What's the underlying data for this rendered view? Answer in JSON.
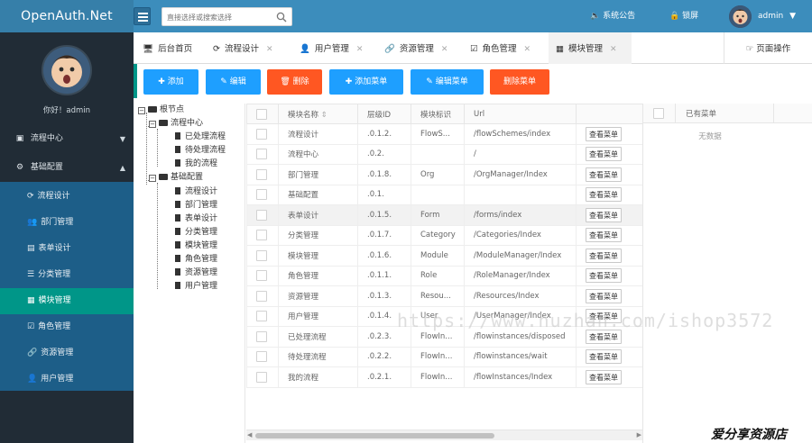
{
  "app": {
    "title": "OpenAuth.Net"
  },
  "header": {
    "search_placeholder": "直接选择或搜索选择",
    "announcement": "系统公告",
    "lock": "锁屏",
    "user": "admin"
  },
  "sidebar": {
    "greeting": "你好！admin",
    "groups": [
      {
        "label": "流程中心"
      },
      {
        "label": "基础配置"
      }
    ],
    "items": [
      {
        "label": "流程设计"
      },
      {
        "label": "部门管理"
      },
      {
        "label": "表单设计"
      },
      {
        "label": "分类管理"
      },
      {
        "label": "模块管理"
      },
      {
        "label": "角色管理"
      },
      {
        "label": "资源管理"
      },
      {
        "label": "用户管理"
      }
    ]
  },
  "tabs": [
    {
      "label": "后台首页"
    },
    {
      "label": "流程设计"
    },
    {
      "label": "用户管理"
    },
    {
      "label": "资源管理"
    },
    {
      "label": "角色管理"
    },
    {
      "label": "模块管理"
    }
  ],
  "page_ops": "页面操作",
  "toolbar": {
    "add": "添加",
    "edit": "编辑",
    "delete": "删除",
    "add_menu": "添加菜单",
    "edit_menu": "编辑菜单",
    "delete_menu": "删除菜单"
  },
  "tree": {
    "root": "根节点",
    "nodes": [
      {
        "label": "流程中心",
        "children": [
          "已处理流程",
          "待处理流程",
          "我的流程"
        ]
      },
      {
        "label": "基础配置",
        "children": [
          "流程设计",
          "部门管理",
          "表单设计",
          "分类管理",
          "模块管理",
          "角色管理",
          "资源管理",
          "用户管理"
        ]
      }
    ]
  },
  "grid": {
    "columns": [
      "模块名称",
      "层级ID",
      "模块标识",
      "Url",
      ""
    ],
    "view_label": "查看菜单",
    "rows": [
      {
        "name": "流程设计",
        "cascade": ".0.1.2.",
        "code": "FlowS...",
        "url": "/flowSchemes/index"
      },
      {
        "name": "流程中心",
        "cascade": ".0.2.",
        "code": "",
        "url": "/"
      },
      {
        "name": "部门管理",
        "cascade": ".0.1.8.",
        "code": "Org",
        "url": "/OrgManager/Index"
      },
      {
        "name": "基础配置",
        "cascade": ".0.1.",
        "code": "",
        "url": ""
      },
      {
        "name": "表单设计",
        "cascade": ".0.1.5.",
        "code": "Form",
        "url": "/forms/index"
      },
      {
        "name": "分类管理",
        "cascade": ".0.1.7.",
        "code": "Category",
        "url": "/Categories/Index"
      },
      {
        "name": "模块管理",
        "cascade": ".0.1.6.",
        "code": "Module",
        "url": "/ModuleManager/Index"
      },
      {
        "name": "角色管理",
        "cascade": ".0.1.1.",
        "code": "Role",
        "url": "/RoleManager/Index"
      },
      {
        "name": "资源管理",
        "cascade": ".0.1.3.",
        "code": "Resou...",
        "url": "/Resources/Index"
      },
      {
        "name": "用户管理",
        "cascade": ".0.1.4.",
        "code": "User",
        "url": "/UserManager/Index"
      },
      {
        "name": "已处理流程",
        "cascade": ".0.2.3.",
        "code": "FlowIn...",
        "url": "/flowinstances/disposed"
      },
      {
        "name": "待处理流程",
        "cascade": ".0.2.2.",
        "code": "FlowIn...",
        "url": "/flowinstances/wait"
      },
      {
        "name": "我的流程",
        "cascade": ".0.2.1.",
        "code": "FlowIn...",
        "url": "/flowInstances/Index"
      }
    ]
  },
  "right_grid": {
    "header": "已有菜单",
    "empty": "无数据"
  },
  "watermark": "https://www.huzhan.com/ishop3572",
  "footer_mark": "爱分享资源店"
}
